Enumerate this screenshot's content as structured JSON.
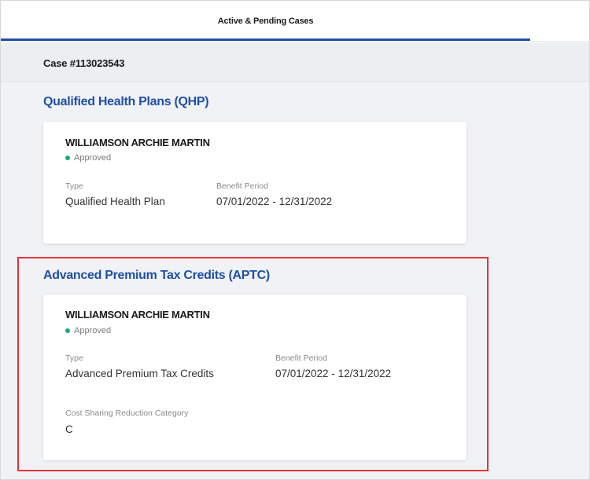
{
  "tabs": {
    "active_label": "Active & Pending Cases"
  },
  "case": {
    "number_label": "Case #113023543"
  },
  "qhp_section": {
    "title": "Qualified Health Plans (QHP)",
    "card": {
      "name": "WILLIAMSON ARCHIE MARTIN",
      "status": "Approved",
      "type_label": "Type",
      "type_value": "Qualified Health Plan",
      "period_label": "Benefit Period",
      "period_value": "07/01/2022 - 12/31/2022"
    }
  },
  "aptc_section": {
    "title": "Advanced Premium Tax Credits (APTC)",
    "card": {
      "name": "WILLIAMSON ARCHIE MARTIN",
      "status": "Approved",
      "type_label": "Type",
      "type_value": "Advanced Premium Tax Credits",
      "period_label": "Benefit Period",
      "period_value": "07/01/2022 - 12/31/2022",
      "csr_label": "Cost Sharing Reduction Category",
      "csr_value": "C"
    }
  },
  "colors": {
    "accent_blue": "#1f4fa3",
    "approved_green": "#1fa87a",
    "highlight_red": "#e3343a",
    "background": "#f1f2f5"
  }
}
